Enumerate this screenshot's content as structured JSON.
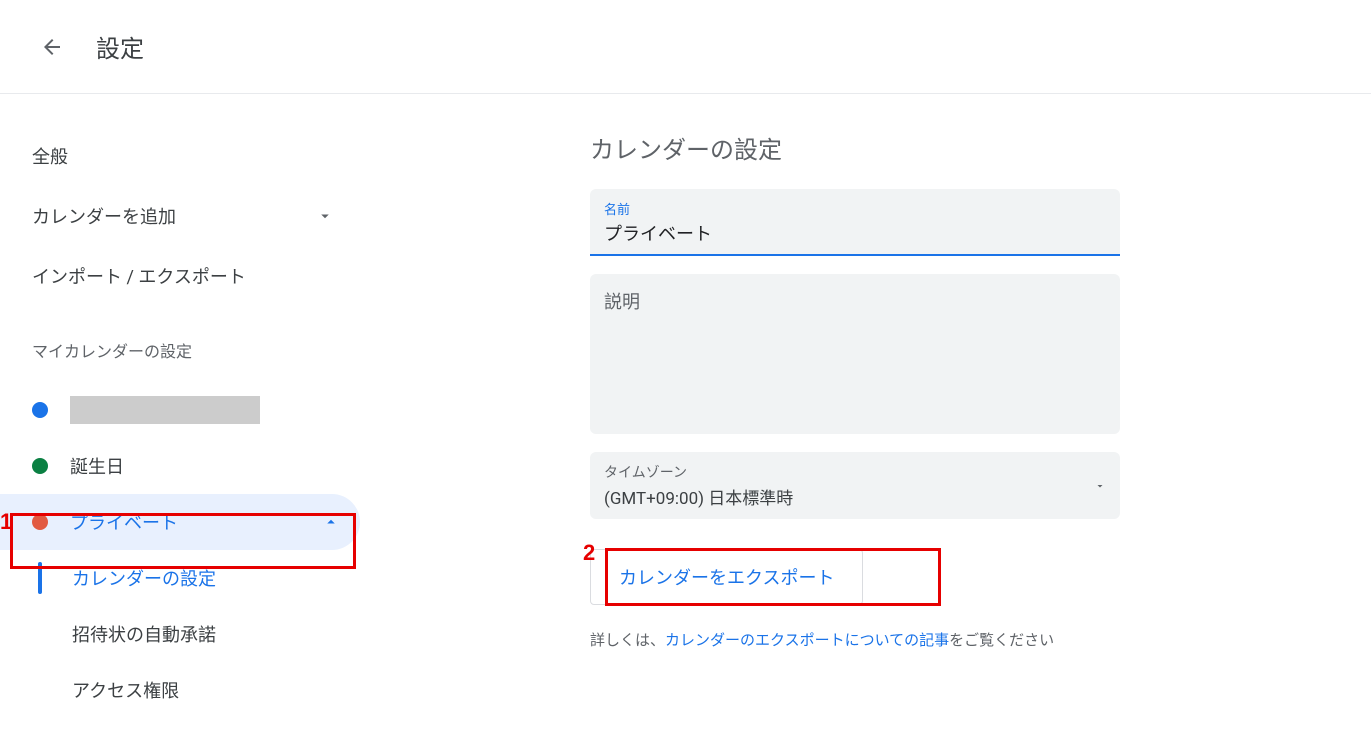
{
  "header": {
    "title": "設定"
  },
  "sidebar": {
    "nav": [
      {
        "label": "全般"
      },
      {
        "label": "カレンダーを追加"
      },
      {
        "label": "インポート / エクスポート"
      }
    ],
    "my_calendars_header": "マイカレンダーの設定",
    "calendars": [
      {
        "label": "",
        "color": "#1a73e8",
        "redacted": true
      },
      {
        "label": "誕生日",
        "color": "#0b8043"
      },
      {
        "label": "プライベート",
        "color": "#e25a42",
        "selected": true,
        "expanded": true
      }
    ],
    "sub_items": [
      {
        "label": "カレンダーの設定",
        "active": true
      },
      {
        "label": "招待状の自動承諾"
      },
      {
        "label": "アクセス権限"
      }
    ]
  },
  "main": {
    "title": "カレンダーの設定",
    "name_field": {
      "label": "名前",
      "value": "プライベート"
    },
    "description_placeholder": "説明",
    "timezone": {
      "label": "タイムゾーン",
      "value": "(GMT+09:00) 日本標準時"
    },
    "export_button": "カレンダーをエクスポート",
    "more_info_prefix": "詳しくは、",
    "more_info_link": "カレンダーのエクスポートについての記事",
    "more_info_suffix": "をご覧ください"
  },
  "annotations": {
    "one": "1",
    "two": "2"
  }
}
